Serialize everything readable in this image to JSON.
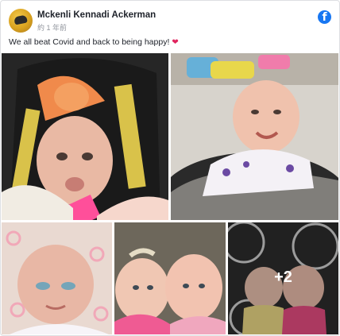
{
  "post": {
    "author": "Mckenli Kennadi Ackerman",
    "time": "約 1 年前",
    "text": "We all beat Covid and back to being happy!",
    "emoji": "heart-emoji"
  },
  "platform": {
    "icon": "facebook-logo-icon",
    "glyph": "f",
    "color": "#1877f2"
  },
  "photos": {
    "more_count": "+2",
    "items": [
      {
        "name": "baby-in-car-seat-photo"
      },
      {
        "name": "baby-on-rug-photo"
      },
      {
        "name": "baby-closeup-photo"
      },
      {
        "name": "two-babies-photo"
      },
      {
        "name": "two-babies-on-rug-photo"
      }
    ]
  }
}
